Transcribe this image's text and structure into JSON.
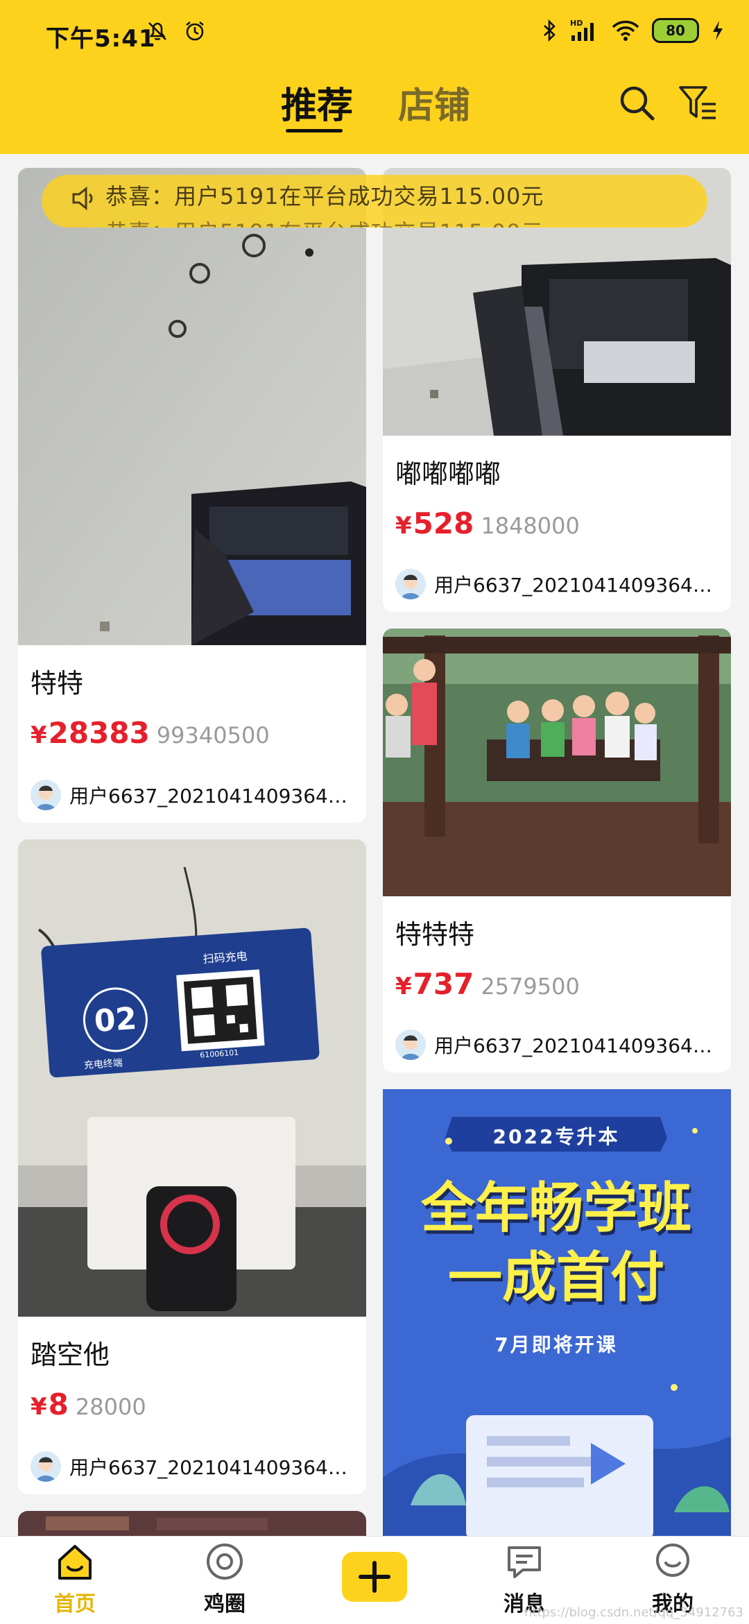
{
  "status_bar": {
    "time": "下午5:41",
    "battery": "80"
  },
  "header": {
    "tabs": [
      {
        "label": "推荐",
        "active": true
      },
      {
        "label": "店铺",
        "active": false
      }
    ]
  },
  "marquee": {
    "line1": "恭喜：用户5191在平台成功交易115.00元",
    "line2": "恭喜：用户5191在平台成功交易115.00元"
  },
  "feed": {
    "left": [
      {
        "title": "特特",
        "price": "28383",
        "original": "99340500",
        "user": "用户6637_20210414093642..."
      },
      {
        "title": "踏空他",
        "price": "8",
        "original": "28000",
        "user": "用户6637_20210414093642..."
      }
    ],
    "right": [
      {
        "title": "嘟嘟嘟嘟",
        "price": "528",
        "original": "1848000",
        "user": "用户6637_20210414093642..."
      },
      {
        "title": "特特特",
        "price": "737",
        "original": "2579500",
        "user": "用户6637_20210414093642..."
      }
    ],
    "currency": "¥",
    "ad": {
      "banner": "2022专升本",
      "line1": "全年畅学班",
      "line2": "一成首付",
      "sub": "7月即将开课"
    },
    "qr_card": {
      "label": "扫码充电",
      "number": "02",
      "footer": "充电终端",
      "code": "61006101"
    }
  },
  "bottom_nav": {
    "items": [
      {
        "label": "首页",
        "active": true
      },
      {
        "label": "鸡圈",
        "active": false
      },
      {
        "label": "消息",
        "active": false
      },
      {
        "label": "我的",
        "active": false
      }
    ]
  },
  "watermark": "https://blog.csdn.net/qq_34912763",
  "colors": {
    "brand_yellow": "#fdd21c",
    "price_red": "#e5202b",
    "active_nav": "#e7b500"
  }
}
